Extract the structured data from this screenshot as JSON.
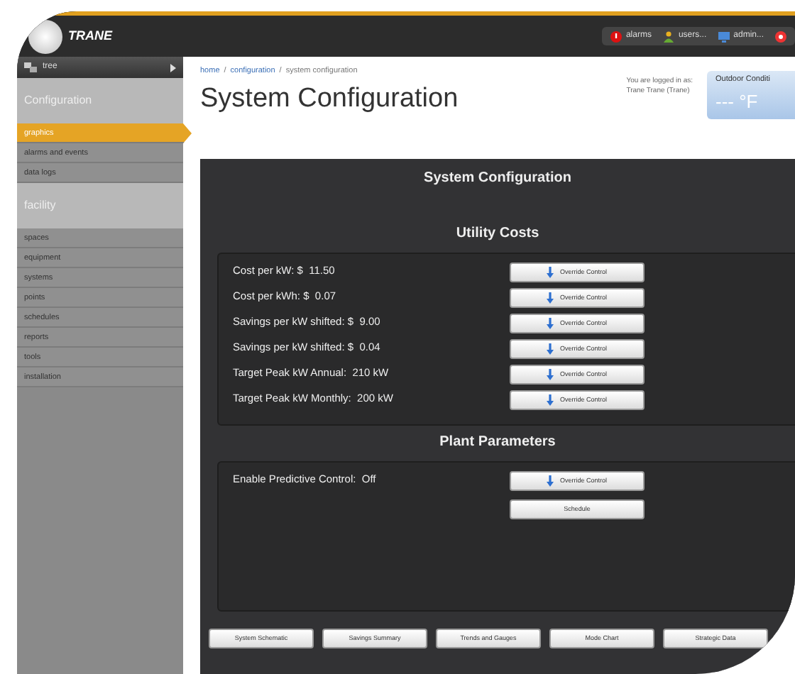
{
  "header": {
    "logo_text": "TRANE",
    "menu": [
      {
        "kind": "alarm",
        "label": "alarms"
      },
      {
        "kind": "user",
        "label": "users..."
      },
      {
        "kind": "admin",
        "label": "admin..."
      },
      {
        "kind": "help"
      }
    ]
  },
  "sidebar": {
    "tree_label": "tree",
    "sections": [
      {
        "title": "Configuration",
        "items": [
          {
            "label": "graphics",
            "selected": true
          },
          {
            "label": "alarms and events",
            "selected": false
          },
          {
            "label": "data logs",
            "selected": false
          }
        ]
      },
      {
        "title": "facility",
        "items": [
          {
            "label": "spaces",
            "selected": false
          },
          {
            "label": "equipment",
            "selected": false
          },
          {
            "label": "systems",
            "selected": false
          },
          {
            "label": "points",
            "selected": false
          },
          {
            "label": "schedules",
            "selected": false
          },
          {
            "label": "reports",
            "selected": false
          },
          {
            "label": "tools",
            "selected": false
          },
          {
            "label": "installation",
            "selected": false
          }
        ]
      }
    ]
  },
  "breadcrumb_separator": "/",
  "breadcrumb": [
    {
      "label": "home",
      "link": true
    },
    {
      "label": "configuration",
      "link": true
    },
    {
      "label": "system configuration",
      "link": false
    }
  ],
  "title": "System Configuration",
  "login": [
    "You are logged in as:",
    "Trane Trane (Trane)"
  ],
  "outdoor": {
    "title": "Outdoor Conditi",
    "value": "---",
    "unit": "°F"
  },
  "panel": {
    "title": "System Configuration",
    "sections": [
      {
        "title": "Utility Costs",
        "rows": [
          {
            "label": "Cost per kW: $",
            "value": "11.50",
            "buttons": [
              {
                "label": "Override Control",
                "icon": true
              }
            ]
          },
          {
            "label": "Cost per kWh: $",
            "value": "0.07",
            "buttons": [
              {
                "label": "Override Control",
                "icon": true
              }
            ]
          },
          {
            "label": "Savings per kW shifted: $",
            "value": "9.00",
            "buttons": [
              {
                "label": "Override Control",
                "icon": true
              }
            ]
          },
          {
            "label": "Savings per kW shifted: $",
            "value": "0.04",
            "buttons": [
              {
                "label": "Override Control",
                "icon": true
              }
            ]
          },
          {
            "label": "Target Peak kW Annual:",
            "value": "210 kW",
            "buttons": [
              {
                "label": "Override Control",
                "icon": true
              }
            ]
          },
          {
            "label": "Target Peak kW Monthly:",
            "value": "200 kW",
            "buttons": [
              {
                "label": "Override Control",
                "icon": true
              }
            ]
          }
        ]
      },
      {
        "title": "Plant Parameters",
        "rows": [
          {
            "label": "Enable Predictive Control:",
            "value": "Off",
            "buttons": [
              {
                "label": "Override Control",
                "icon": true
              },
              {
                "label": "Schedule",
                "icon": false
              }
            ]
          }
        ]
      }
    ],
    "footer_buttons": [
      "System Schematic",
      "Savings Summary",
      "Trends and Gauges",
      "Mode Chart",
      "Strategic Data"
    ]
  }
}
